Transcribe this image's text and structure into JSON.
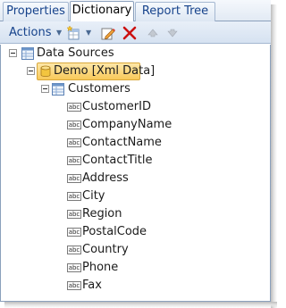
{
  "tabs": [
    {
      "label": "Properties",
      "active": false
    },
    {
      "label": "Dictionary",
      "active": true
    },
    {
      "label": "Report Tree",
      "active": false
    }
  ],
  "toolbar": {
    "actions_label": "Actions",
    "icons": [
      "new-item-icon",
      "edit-icon",
      "delete-icon",
      "move-up-icon",
      "move-down-icon"
    ],
    "colors": {
      "delete": "#cc1111",
      "accent": "#15428b"
    }
  },
  "tree": {
    "root": {
      "label": "Data Sources",
      "expanded": true
    },
    "datasource": {
      "label": "Demo [Xml Data]",
      "selected": true,
      "expanded": true
    },
    "table": {
      "label": "Customers",
      "expanded": true
    },
    "column_icon_text": "abc",
    "columns": [
      "CustomerID",
      "CompanyName",
      "ContactName",
      "ContactTitle",
      "Address",
      "City",
      "Region",
      "PostalCode",
      "Country",
      "Phone",
      "Fax"
    ]
  },
  "selection_color": "#f8c95a"
}
